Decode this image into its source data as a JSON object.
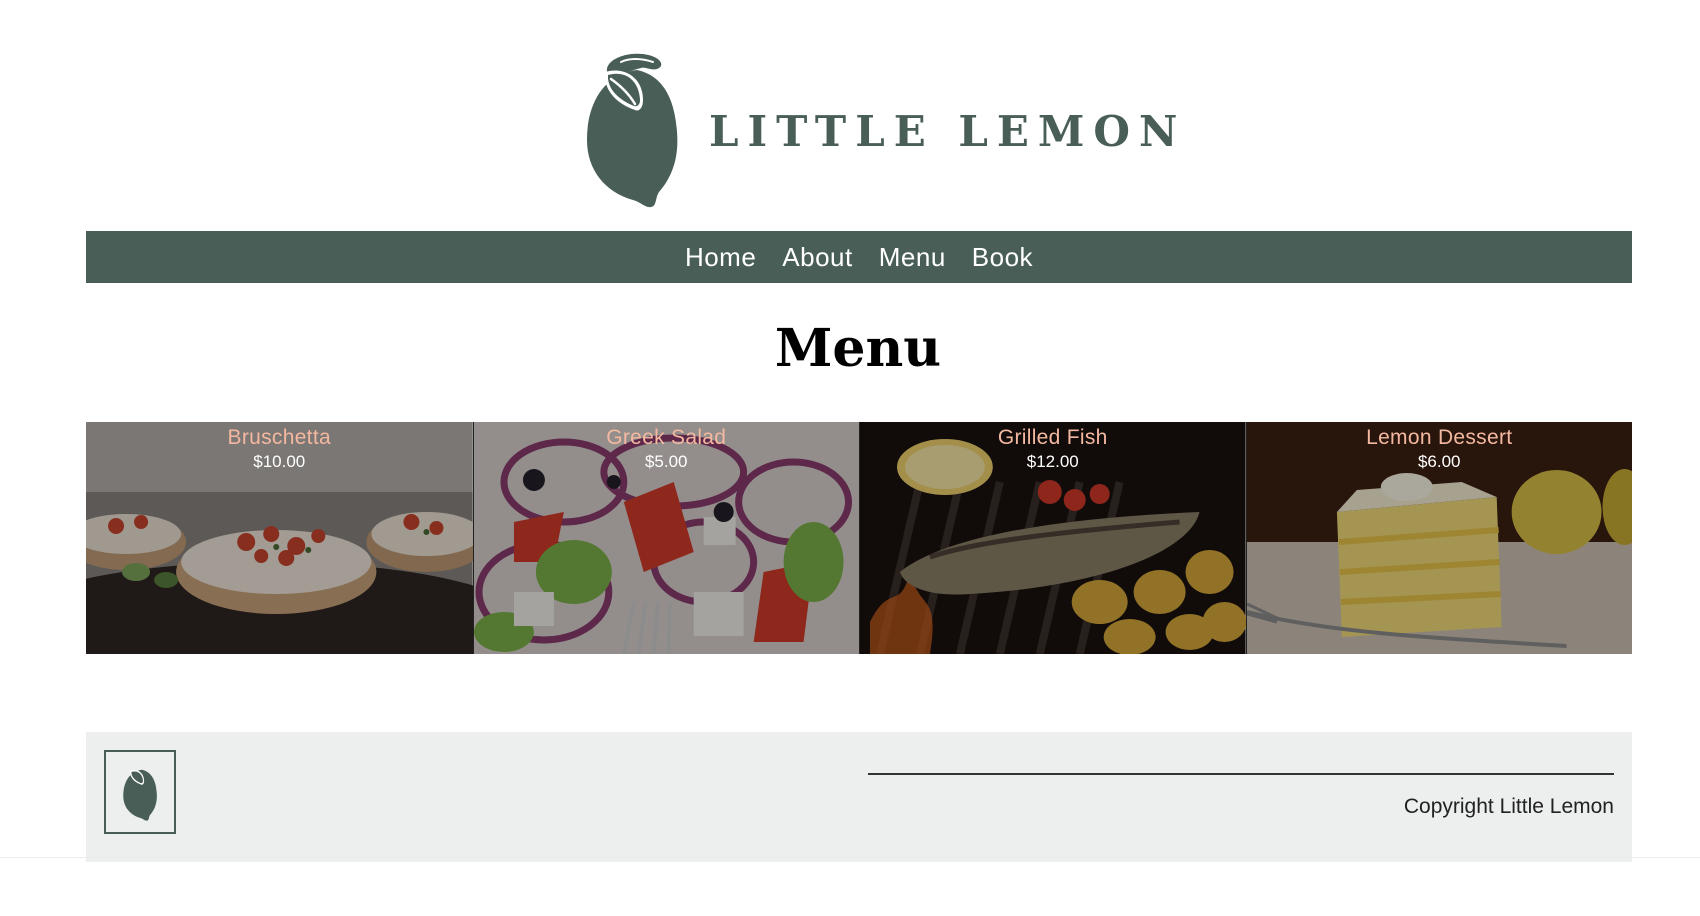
{
  "brand": {
    "name": "LITTLE LEMON",
    "color": "#495e57"
  },
  "nav": {
    "items": [
      {
        "label": "Home"
      },
      {
        "label": "About"
      },
      {
        "label": "Menu"
      },
      {
        "label": "Book"
      }
    ]
  },
  "page": {
    "title": "Menu"
  },
  "menu": {
    "items": [
      {
        "name": "Bruschetta",
        "price": "$10.00"
      },
      {
        "name": "Greek Salad",
        "price": "$5.00"
      },
      {
        "name": "Grilled Fish",
        "price": "$12.00"
      },
      {
        "name": "Lemon Dessert",
        "price": "$6.00"
      }
    ]
  },
  "footer": {
    "copyright": "Copyright Little Lemon"
  },
  "icons": {
    "logo": "lemon-icon",
    "footer_logo": "lemon-icon"
  }
}
